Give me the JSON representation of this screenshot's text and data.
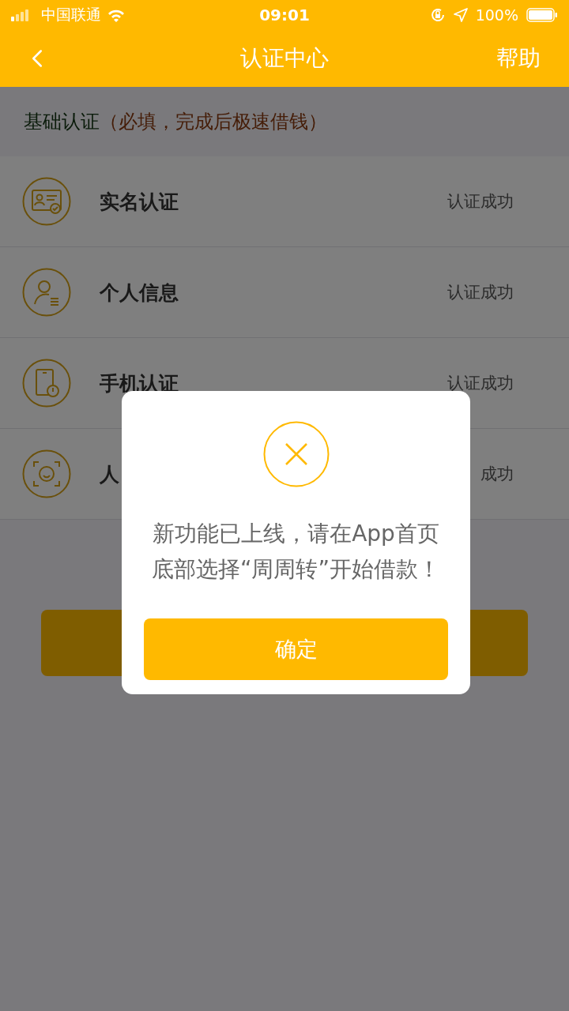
{
  "status_bar": {
    "carrier": "中国联通",
    "time": "09:01",
    "battery": "100%"
  },
  "nav": {
    "title": "认证中心",
    "action": "帮助"
  },
  "section": {
    "title": "基础认证",
    "note": "（必填，完成后极速借钱）"
  },
  "items": [
    {
      "kind": "id-card",
      "title": "实名认证",
      "status": "认证成功"
    },
    {
      "kind": "person",
      "title": "个人信息",
      "status": "认证成功"
    },
    {
      "kind": "phone",
      "title": "手机认证",
      "status": "认证成功"
    },
    {
      "kind": "face",
      "title": "人",
      "status": "成功"
    }
  ],
  "dialog": {
    "message": "新功能已上线，请在App首页底部选择“周周转”开始借款！",
    "button": "确定"
  }
}
